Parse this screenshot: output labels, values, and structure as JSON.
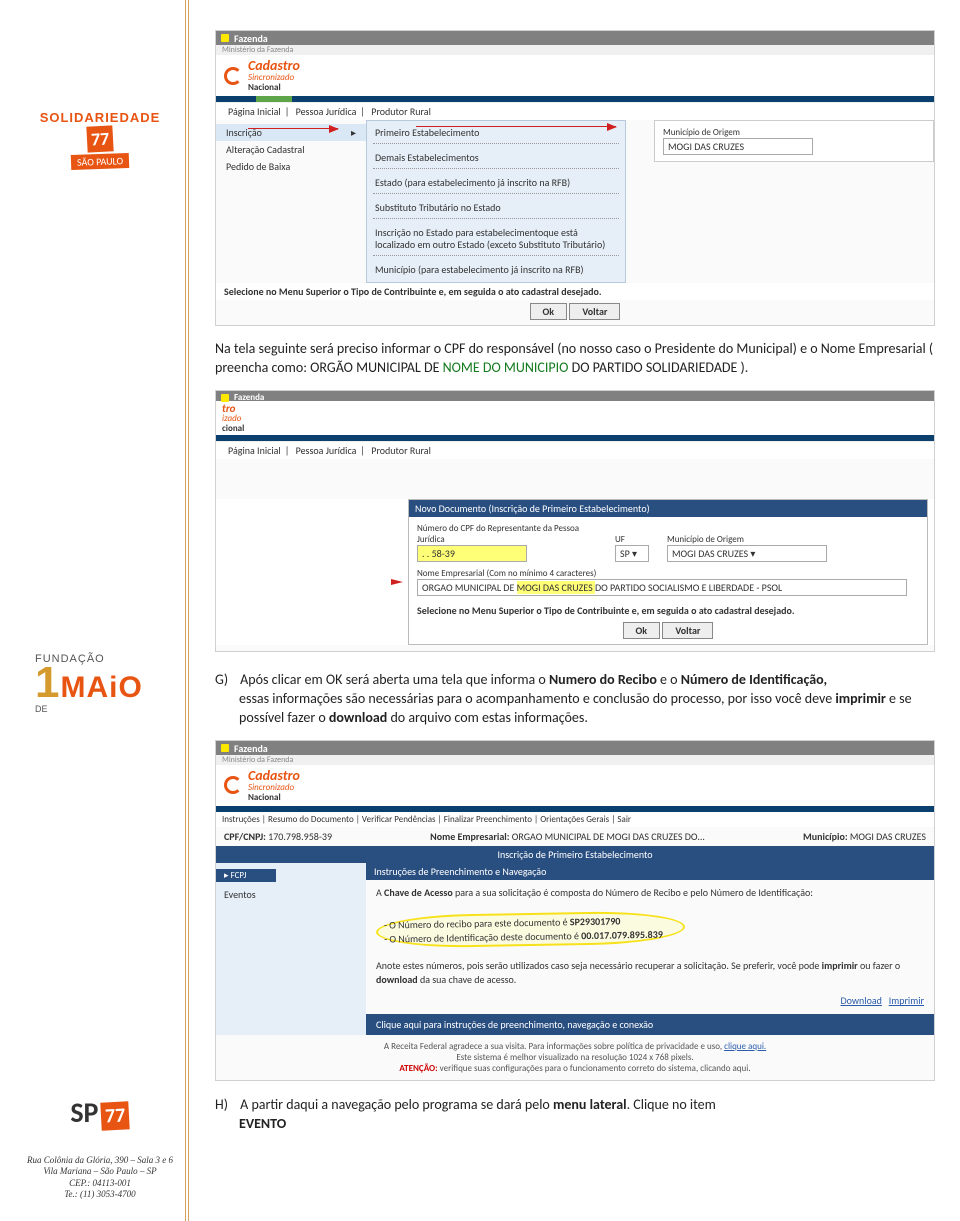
{
  "sidebar": {
    "solid_logo": "SOLIDARIEDADE",
    "solid_77": "77",
    "solid_sub": "SÃO PAULO",
    "fund_small": "FUNDAÇÃO",
    "fund_one": "1",
    "fund_maio": "MAiO",
    "fund_de": "DE",
    "sp_sp": "SP",
    "sp_77": "77"
  },
  "footer": {
    "l1": "Rua Colônia da Glória, 390 – Sala 3 e 6",
    "l2": "Vila Mariana – São Paulo – SP",
    "l3": "CEP.: 04113-001",
    "l4": "Te.: (11) 3053-4700"
  },
  "intro": {
    "text_a": "Na tela seguinte será preciso informar o CPF do responsável (no nosso caso o Presidente do Municipal) e o Nome Empresarial ( preencha como: ORGÃO MUNICIPAL DE ",
    "text_green": "NOME DO MUNICIPIO",
    "text_b": " DO PARTIDO SOLIDARIEDADE )."
  },
  "shot_common": {
    "fazenda": "Fazenda",
    "min": "Ministério da Fazenda",
    "cad_main": "Cadastro",
    "cad_sub": "Sincronizado",
    "cad_nac": "Nacional",
    "nav_home": "Página Inicial",
    "nav_pj": "Pessoa Jurídica",
    "nav_pr": "Produtor Rural"
  },
  "shot1": {
    "menu": {
      "inscricao": "Inscrição",
      "alteracao": "Alteração Cadastral",
      "baixa": "Pedido de Baixa"
    },
    "submenu": {
      "i0": "Primeiro Estabelecimento",
      "i1": "Demais Estabelecimentos",
      "i2": "Estado (para estabelecimento já inscrito na RFB)",
      "i3": "Substituto Tributário no Estado",
      "i4": "Inscrição no Estado para estabelecimentoque está localizado em outro Estado (exceto Substituto Tributário)",
      "i5": "Município (para estabelecimento já inscrito na RFB)"
    },
    "form": {
      "lbl_mun": "Município de Origem",
      "val_mun": "MOGI DAS CRUZES"
    },
    "sel_note": "Selecione no Menu Superior o Tipo de Contribuinte e, em seguida o ato cadastral desejado.",
    "btn_ok": "Ok",
    "btn_volt": "Voltar"
  },
  "shot2": {
    "panel_title": "Novo Documento (Inscrição de Primeiro Estabelecimento)",
    "lbl_cpf": "Número do CPF do Representante da Pessoa Jurídica",
    "val_cpf": "   .   .   58-39",
    "lbl_uf": "UF",
    "val_uf": "SP",
    "lbl_mun": "Município de Origem",
    "val_mun": "MOGI DAS CRUZES",
    "lbl_nome": "Nome Empresarial (Com no mínimo 4 caracteres)",
    "val_nome_a": "ORGAO MUNICIPAL DE ",
    "val_nome_hl": "MOGI DAS CRUZES ",
    "val_nome_b": "DO PARTIDO SOCIALISMO E LIBERDADE - PSOL",
    "sel_note": "Selecione no Menu Superior o Tipo de Contribuinte e, em seguida o ato cadastral desejado.",
    "btn_ok": "Ok",
    "btn_volt": "Voltar"
  },
  "para_G": {
    "letter": "G)",
    "t1": "Após clicar em OK será aberta uma tela que informa o ",
    "b1": "Numero do Recibo",
    "t2": " e o ",
    "b2": "Número de Identificação, ",
    "t3": "essas informações são necessárias para o acompanhamento e conclusão do processo, por isso você deve ",
    "b3": "imprimir",
    "t4": " e se possível fazer o ",
    "b4": "download",
    "t5": " do arquivo com estas informações."
  },
  "shot3": {
    "nav_items": "Instruções | Resumo do Documento | Verificar Pendências | Finalizar Preenchimento | Orientações Gerais | Sair",
    "cpf_lbl": "CPF/CNPJ:",
    "cpf_val": "170.798.958-39",
    "nome_lbl": "Nome Empresarial:",
    "nome_val": "ORGAO MUNICIPAL DE MOGI DAS CRUZES DO...",
    "mun_lbl": "Município:",
    "mun_val": "MOGI DAS CRUZES",
    "title": "Inscrição de Primeiro Estabelecimento",
    "side_grp": "FCPJ",
    "side_ev": "Eventos",
    "main_hd": "Instruções de Preenchimento e Navegação",
    "p1a": "A ",
    "p1b": "Chave de Acesso",
    "p1c": " para a sua solicitação é composta do Número de Recibo e pelo Número de Identificação:",
    "li1": "- O Número do recibo para este documento é ",
    "li1_b": "SP29301790",
    "li2": "- O Número de Identificação deste documento é ",
    "li2_b": "00.017.079.895.839",
    "p2a": "Anote estes números, pois serão utilizados caso seja necessário recuperar a solicitação. Se preferir, você pode ",
    "p2b": "imprimir",
    "p2c": " ou fazer o ",
    "p2d": "download",
    "p2e": " da sua chave de acesso.",
    "link_dl": "Download",
    "link_imp": "Imprimir",
    "foot": "Clique aqui para instruções de preenchimento, navegação e conexão",
    "bt1a": "A Receita Federal agradece a sua visita. Para informações sobre política de privacidade e uso, ",
    "bt1b": "clique aqui.",
    "bt2": "Este sistema é melhor visualizado na resolução 1024 x 768 pixels.",
    "bt3a": "ATENÇÃO:",
    "bt3b": " verifique suas configurações para o funcionamento correto do sistema, clicando aqui."
  },
  "para_H": {
    "letter": "H)",
    "t1": "A partir daqui a navegação pelo programa se dará pelo ",
    "b1": "menu lateral",
    "t2": ". Clique no item ",
    "b2": "EVENTO"
  }
}
